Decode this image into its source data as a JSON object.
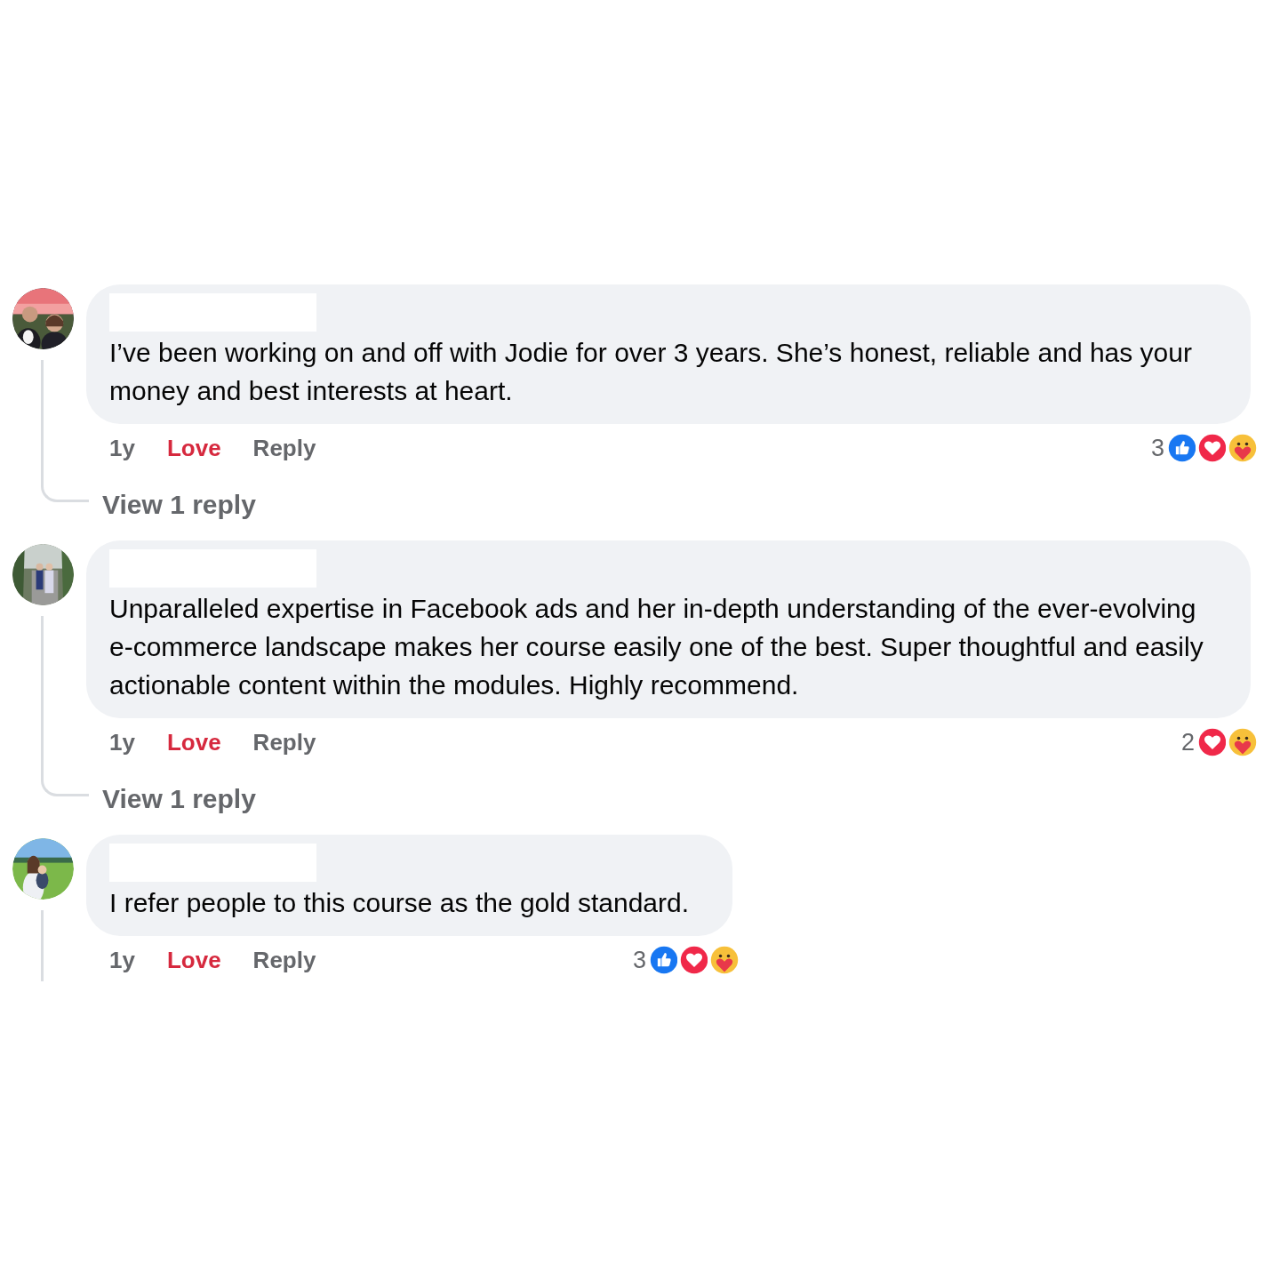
{
  "comments": [
    {
      "avatar": {
        "kind": "picture"
      },
      "text": "I’ve been working on and off with Jodie for over 3 years. She’s honest, reliable and has your money and best interests at heart.",
      "time": "1y",
      "reaction_button": {
        "label": "Love",
        "reacted": true
      },
      "reply_label": "Reply",
      "reaction_count": "3",
      "reactions": [
        {
          "kind": "like"
        },
        {
          "kind": "love"
        },
        {
          "kind": "care"
        }
      ],
      "view_replies": "View 1 reply"
    },
    {
      "avatar": {
        "kind": "picture"
      },
      "text": "Unparalleled expertise in Facebook ads and her in-depth understanding of the ever-evolving e-commerce landscape makes her course easily one of the best. Super thoughtful and easily actionable content within the modules. Highly recommend.",
      "time": "1y",
      "reaction_button": {
        "label": "Love",
        "reacted": true
      },
      "reply_label": "Reply",
      "reaction_count": "2",
      "reactions": [
        {
          "kind": "love"
        },
        {
          "kind": "care"
        }
      ],
      "view_replies": "View 1 reply"
    },
    {
      "avatar": {
        "kind": "picture"
      },
      "text": "I refer people to this course as the gold standard.",
      "time": "1y",
      "reaction_button": {
        "label": "Love",
        "reacted": true
      },
      "reply_label": "Reply",
      "reaction_count": "3",
      "reactions": [
        {
          "kind": "like"
        },
        {
          "kind": "love"
        },
        {
          "kind": "care"
        }
      ]
    }
  ]
}
